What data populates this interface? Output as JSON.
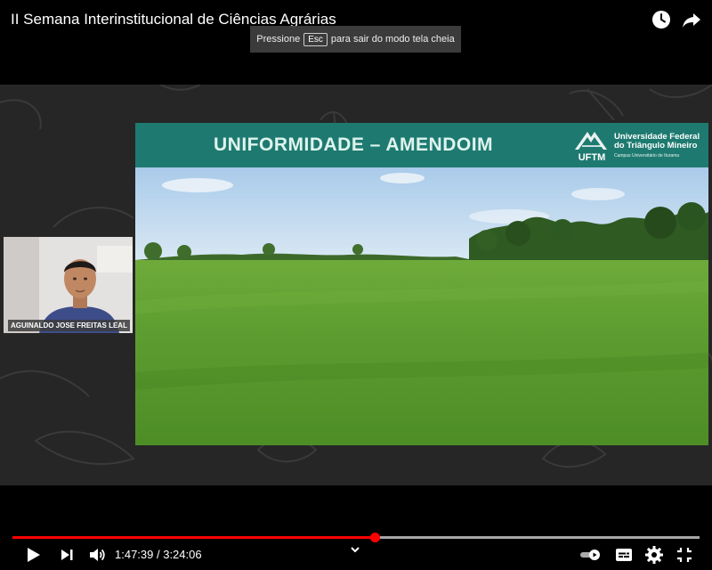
{
  "header": {
    "video_title": "II Semana Interinstitucional de Ciências Agrárias"
  },
  "fullscreen_hint": {
    "before": "Pressione",
    "key": "Esc",
    "after": "para sair do modo tela cheia"
  },
  "webcam": {
    "speaker_name": "AGUINALDO JOSE FREITAS LEAL"
  },
  "slide": {
    "title": "UNIFORMIDADE – AMENDOIM",
    "logo_abbrev": "UFTM",
    "logo_line1": "Universidade Federal",
    "logo_line2": "do Triângulo Mineiro",
    "logo_line3": "Campus Universitário de Iturama"
  },
  "player": {
    "current_time": "1:47:39",
    "duration": "3:24:06",
    "time_display": "1:47:39 / 3:24:06",
    "progress_fraction": 0.527,
    "buffer_fraction": 1.0
  },
  "colors": {
    "accent": "#ff0000",
    "slide_header": "#1e7a70",
    "stage_bg": "#262626"
  },
  "icons": {
    "watch_later": "clock-icon",
    "share": "share-arrow-icon",
    "play": "play-icon",
    "next": "next-track-icon",
    "volume": "speaker-icon",
    "autoplay": "autoplay-toggle-icon",
    "subtitles": "subtitles-icon",
    "settings": "gear-icon",
    "fullscreen_exit": "exit-fullscreen-icon"
  }
}
